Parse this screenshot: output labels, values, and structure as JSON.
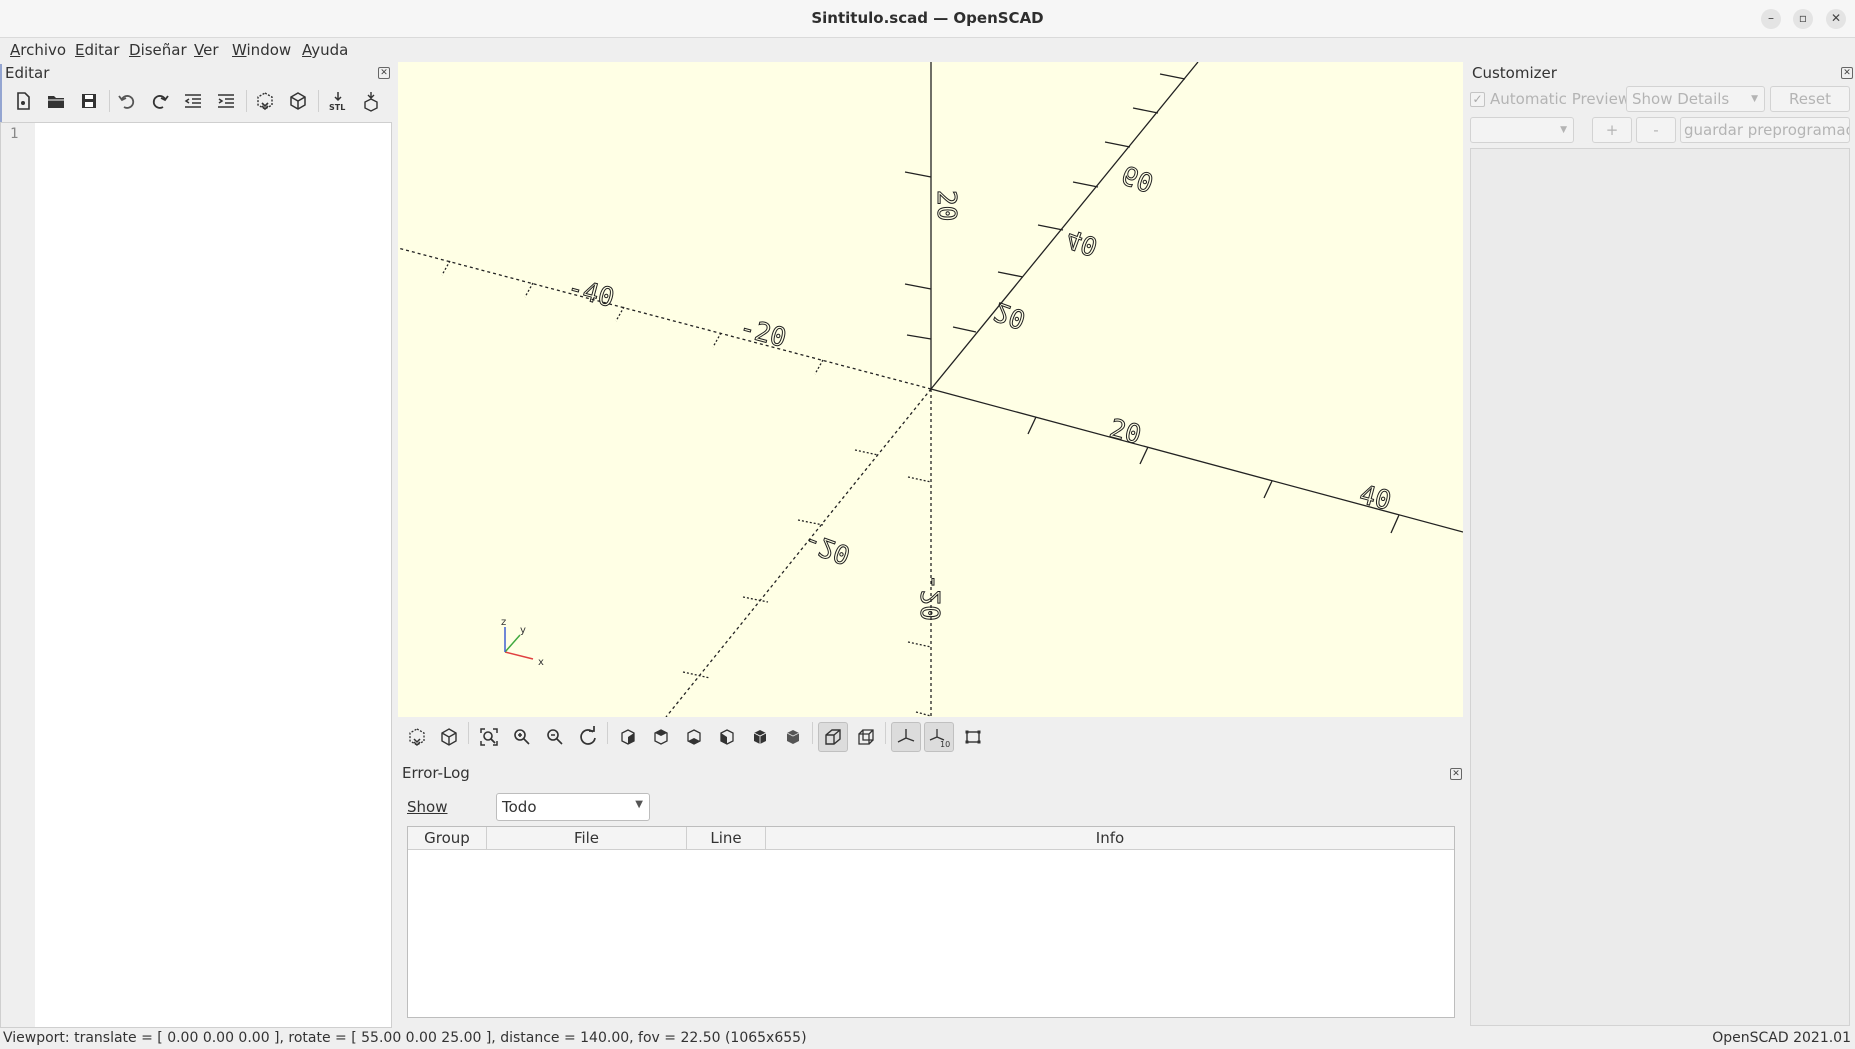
{
  "window": {
    "title": "Sintitulo.scad — OpenSCAD",
    "controls": {
      "minimize": "–",
      "maximize": "▫",
      "close": "✕"
    }
  },
  "menu": [
    "Archivo",
    "Editar",
    "Diseñar",
    "Ver",
    "Window",
    "Ayuda"
  ],
  "editor": {
    "dock_title": "Editar",
    "toolbar_icons": [
      "new-file-icon",
      "open-file-icon",
      "save-icon",
      "undo-icon",
      "redo-icon",
      "unindent-icon",
      "indent-icon",
      "preview-icon",
      "render-icon",
      "export-stl-icon",
      "send-to-print-icon"
    ],
    "line_numbers": [
      "1"
    ],
    "code": ""
  },
  "viewport": {
    "background": "#ffffe5",
    "axis_labels": {
      "x_pos": [
        "20",
        "40"
      ],
      "x_neg": [
        "-20",
        "-40"
      ],
      "y_pos": [
        "20",
        "40",
        "60"
      ],
      "y_neg": [
        "-20"
      ],
      "z_pos": [
        "20"
      ],
      "z_neg": [
        "-20"
      ]
    },
    "gizmo": {
      "x": "x",
      "y": "y",
      "z": "z"
    },
    "colors": {
      "x_axis": "#e04040",
      "y_axis": "#3fa93f",
      "z_axis": "#3f5fd0"
    }
  },
  "view_toolbar": {
    "icons": [
      "preview-icon",
      "render-icon",
      "view-all-icon",
      "zoom-in-icon",
      "zoom-out-icon",
      "reset-view-icon",
      "view-right-icon",
      "view-top-icon",
      "view-bottom-icon",
      "view-left-icon",
      "view-front-icon",
      "view-back-icon",
      "perspective-icon",
      "orthogonal-icon",
      "show-axes-icon",
      "show-scale-markers-icon",
      "show-edges-icon"
    ],
    "active": [
      "perspective-icon",
      "show-axes-icon",
      "show-scale-markers-icon"
    ]
  },
  "errorlog": {
    "title": "Error-Log",
    "show_label": "Show",
    "show_value": "Todo",
    "columns": [
      "Group",
      "File",
      "Line",
      "Info"
    ],
    "rows": []
  },
  "customizer": {
    "title": "Customizer",
    "automatic_preview_label": "Automatic Preview",
    "automatic_preview_checked": true,
    "show_details_value": "Show Details",
    "reset_label": "Reset",
    "preset_value": "",
    "add_label": "+",
    "remove_label": "-",
    "save_preset_label": "guardar preprogramado"
  },
  "statusbar": {
    "viewport_info": "Viewport: translate = [ 0.00 0.00 0.00 ], rotate = [ 55.00 0.00 25.00 ], distance = 140.00, fov = 22.50 (1065x655)",
    "version": "OpenSCAD 2021.01"
  }
}
